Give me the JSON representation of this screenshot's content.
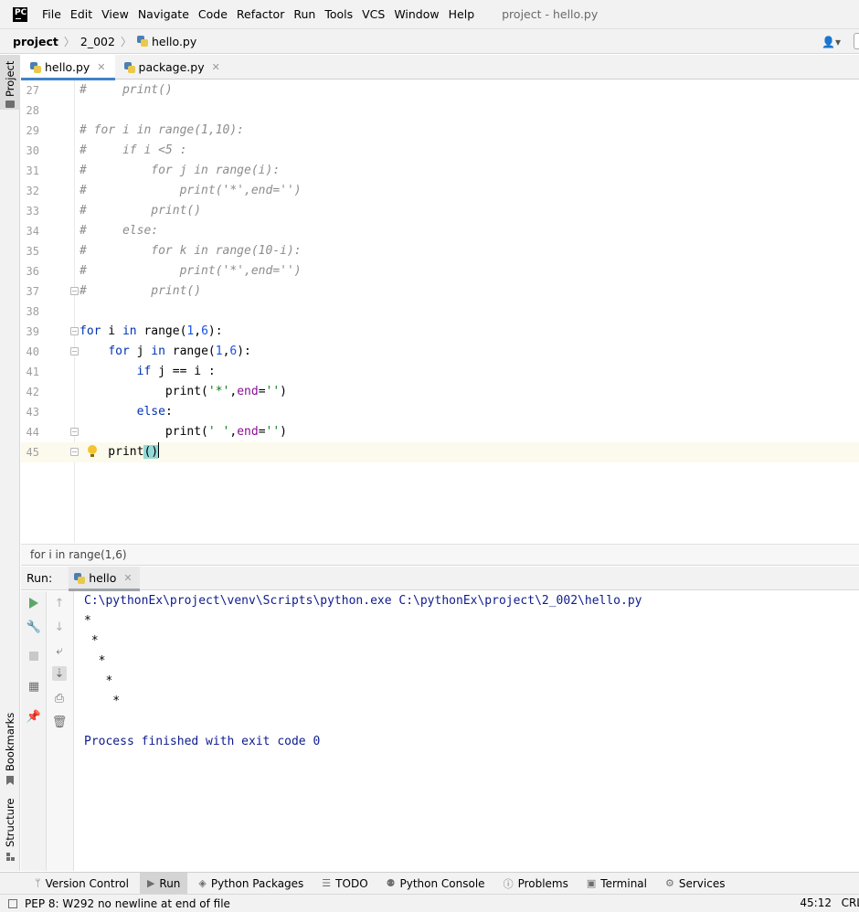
{
  "menu": {
    "items": [
      {
        "label": "File"
      },
      {
        "label": "Edit"
      },
      {
        "label": "View"
      },
      {
        "label": "Navigate"
      },
      {
        "label": "Code"
      },
      {
        "label": "Refactor"
      },
      {
        "label": "Run"
      },
      {
        "label": "Tools"
      },
      {
        "label": "VCS"
      },
      {
        "label": "Window"
      },
      {
        "label": "Help"
      }
    ],
    "window_title": "project - hello.py",
    "logo": "PC"
  },
  "breadcrumb": {
    "project": "project",
    "folder": "2_002",
    "file": "hello.py"
  },
  "side_tabs": {
    "project": "Project",
    "bookmarks": "Bookmarks",
    "structure": "Structure"
  },
  "editor_tabs": [
    {
      "label": "hello.py",
      "active": true
    },
    {
      "label": "package.py",
      "active": false
    }
  ],
  "code_lines": [
    {
      "n": "27"
    },
    {
      "n": "28"
    },
    {
      "n": "29"
    },
    {
      "n": "30"
    },
    {
      "n": "31"
    },
    {
      "n": "32"
    },
    {
      "n": "33"
    },
    {
      "n": "34"
    },
    {
      "n": "35"
    },
    {
      "n": "36"
    },
    {
      "n": "37"
    },
    {
      "n": "38"
    },
    {
      "n": "39"
    },
    {
      "n": "40"
    },
    {
      "n": "41"
    },
    {
      "n": "42"
    },
    {
      "n": "43"
    },
    {
      "n": "44"
    },
    {
      "n": "45"
    }
  ],
  "code_breadcrumb": "for i in range(1,6)",
  "run_panel": {
    "title": "Run:",
    "tab_label": "hello",
    "output": [
      "C:\\pythonEx\\project\\venv\\Scripts\\python.exe C:\\pythonEx\\project\\2_002\\hello.py",
      "*",
      " *",
      "  *",
      "   *",
      "    *",
      "",
      "Process finished with exit code 0"
    ]
  },
  "bottom_tabs": [
    {
      "label": "Version Control",
      "icon": "branch-icon"
    },
    {
      "label": "Run",
      "icon": "run-icon"
    },
    {
      "label": "Python Packages",
      "icon": "layers-icon"
    },
    {
      "label": "TODO",
      "icon": "list-icon"
    },
    {
      "label": "Python Console",
      "icon": "python-icon"
    },
    {
      "label": "Problems",
      "icon": "info-icon"
    },
    {
      "label": "Terminal",
      "icon": "terminal-icon"
    },
    {
      "label": "Services",
      "icon": "services-icon"
    }
  ],
  "status": {
    "message": "PEP 8: W292 no newline at end of file",
    "position": "45:12",
    "line_ending": "CRL"
  }
}
